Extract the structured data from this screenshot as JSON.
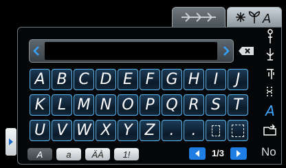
{
  "keyboard": {
    "row1": [
      "A",
      "B",
      "C",
      "D",
      "E",
      "F",
      "G",
      "H",
      "I",
      "J"
    ],
    "row2": [
      "K",
      "L",
      "M",
      "N",
      "O",
      "P",
      "Q",
      "R",
      "S",
      "T"
    ],
    "row3": [
      "U",
      "V",
      "W",
      "X",
      "Y",
      "Z",
      "."
    ]
  },
  "mode_buttons": [
    "A",
    "a",
    "ÄÀ",
    "1!"
  ],
  "pager": {
    "page": "1/3"
  },
  "sidebar": {
    "font_label": "A",
    "no_label": "No"
  },
  "colors": {
    "accent": "#1e7ee4",
    "key_border": "#5cb8f5",
    "arrow": "#37a3ff"
  },
  "icons": {
    "tab_stitch": "stitch-pattern-icon",
    "tab_font": "flower-leaf-letter-icon",
    "delete": "backspace-icon"
  }
}
